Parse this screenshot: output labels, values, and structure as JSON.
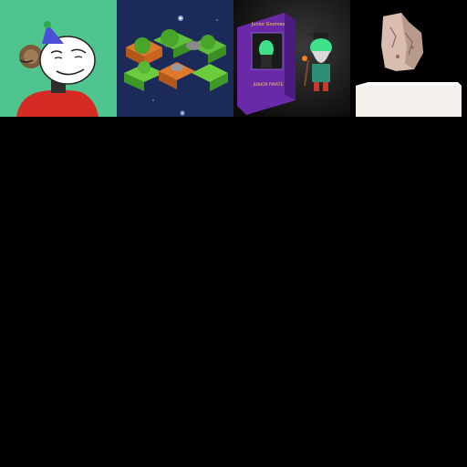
{
  "thumbnails": [
    {
      "subject": "avatar",
      "background": "#4fc48f"
    },
    {
      "subject": "isometric-game",
      "background": "#1c2a5a"
    },
    {
      "subject": "figurine",
      "background": "#101010",
      "box_text": [
        "Junior Gnomes",
        "JUNIOR PIRATE"
      ]
    },
    {
      "subject": "stone-artifact",
      "background": "#000000"
    }
  ]
}
